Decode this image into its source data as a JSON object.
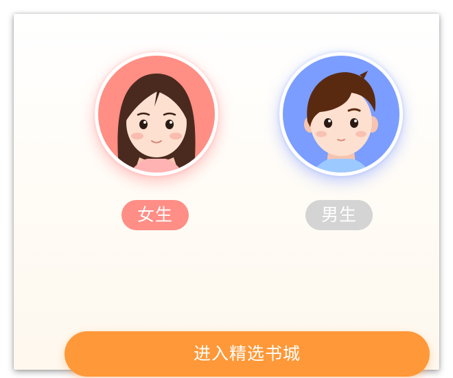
{
  "gender_select": {
    "female": {
      "label": "女生",
      "avatar_color": "#ff8e84",
      "pill_color": "#ff8e86",
      "selected": true
    },
    "male": {
      "label": "男生",
      "avatar_color": "#7a9dff",
      "pill_color": "#d4d4d4",
      "selected": false
    }
  },
  "enter_button": {
    "label": "进入精选书城",
    "color": "#ff9838"
  },
  "icons": [
    "female-avatar-icon",
    "male-avatar-icon"
  ]
}
